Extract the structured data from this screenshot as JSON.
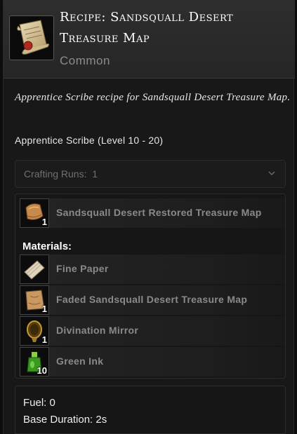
{
  "header": {
    "title_line1": "Recipe: Sandsquall Desert",
    "title_line2": "Treasure Map",
    "rarity": "Common",
    "icon": "treasure-map-scroll-icon"
  },
  "description": "Apprentice Scribe recipe for Sandsquall Desert Treasure Map.",
  "profession": "Apprentice Scribe (Level 10 - 20)",
  "crafting_runs": {
    "label": "Crafting Runs:",
    "value": "1"
  },
  "output": {
    "name": "Sandsquall Desert Restored Treasure Map",
    "qty": "1",
    "icon": "restored-map-icon"
  },
  "materials_heading": "Materials:",
  "materials": [
    {
      "name": "Fine Paper",
      "qty": "",
      "icon": "paper-icon"
    },
    {
      "name": "Faded Sandsquall Desert Treasure Map",
      "qty": "1",
      "icon": "faded-map-icon"
    },
    {
      "name": "Divination Mirror",
      "qty": "1",
      "icon": "mirror-icon"
    },
    {
      "name": "Green Ink",
      "qty": "10",
      "icon": "ink-bottle-icon"
    }
  ],
  "footer": {
    "fuel": "Fuel: 0",
    "duration": "Base Duration: 2s"
  }
}
